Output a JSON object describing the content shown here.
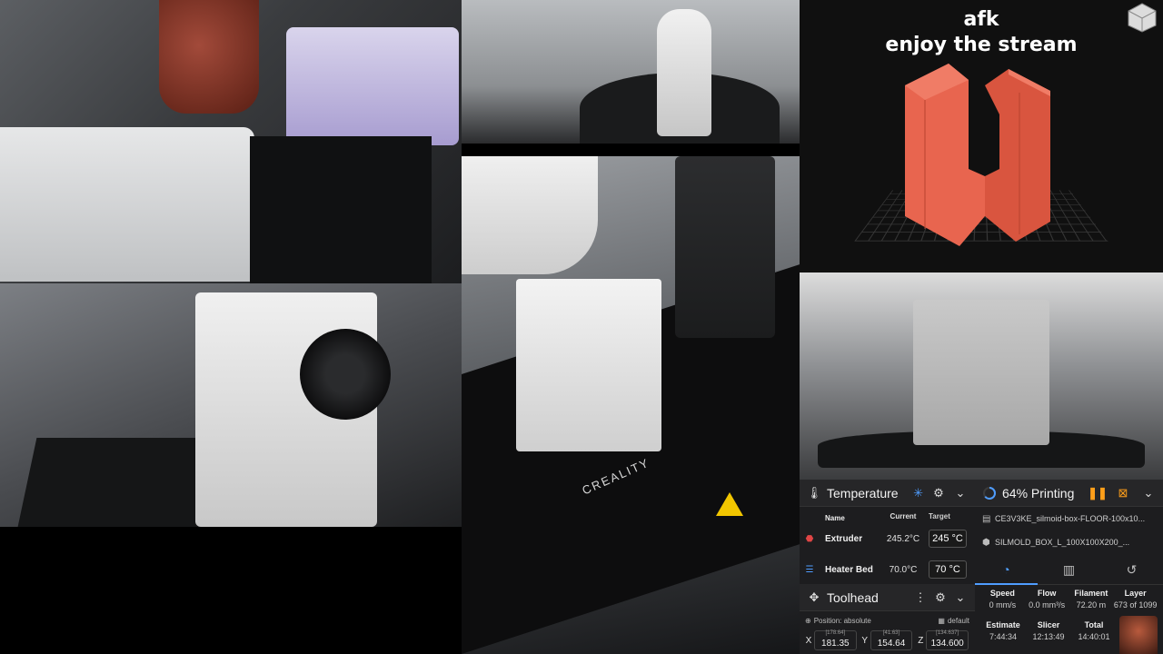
{
  "overlay": {
    "line1": "afk",
    "line2": "enjoy the stream"
  },
  "camera": {
    "bed_brand": "CREALITY"
  },
  "temperature": {
    "title": "Temperature",
    "columns": {
      "name": "Name",
      "current": "Current",
      "target": "Target"
    },
    "rows": [
      {
        "name": "Extruder",
        "current": "245.2°C",
        "target": "245 °C"
      },
      {
        "name": "Heater Bed",
        "current": "70.0°C",
        "target": "70 °C"
      }
    ]
  },
  "toolhead": {
    "title": "Toolhead",
    "position_label": "Position: absolute",
    "profile": "default",
    "axes": [
      {
        "axis": "X",
        "value": "181.35",
        "max": "[178.64]"
      },
      {
        "axis": "Y",
        "value": "154.64",
        "max": "[41.63]"
      },
      {
        "axis": "Z",
        "value": "134.600",
        "max": "[134.637]"
      }
    ]
  },
  "status": {
    "title": "64% Printing",
    "progress_percent": 64,
    "files": [
      "CE3V3KE_silmoid-box-FLOOR-100x10...",
      "SILMOLD_BOX_L_100X100X200_..."
    ],
    "stats": [
      {
        "label": "Speed",
        "value": "0 mm/s"
      },
      {
        "label": "Flow",
        "value": "0.0 mm³/s"
      },
      {
        "label": "Filament",
        "value": "72.20 m"
      },
      {
        "label": "Layer",
        "value": "673 of 1099"
      }
    ],
    "times": [
      {
        "label": "Estimate",
        "value": "7:44:34"
      },
      {
        "label": "Slicer",
        "value": "12:13:49"
      },
      {
        "label": "Total",
        "value": "14:40:01"
      }
    ]
  },
  "colors": {
    "accent": "#4f9dff",
    "pause": "#ff9f1a",
    "model": "#e8654f"
  },
  "icons": {
    "temperature": "snowflake-icon",
    "settings": "gear-icon",
    "collapse": "chevron-down-icon",
    "extruder": "extruder-icon",
    "bed": "heater-bed-icon",
    "toolhead": "move-icon",
    "pause": "pause-icon",
    "cancel": "stop-icon",
    "file": "file-icon",
    "tab_status": "speedometer-icon",
    "tab_files": "document-icon",
    "tab_history": "history-icon"
  }
}
